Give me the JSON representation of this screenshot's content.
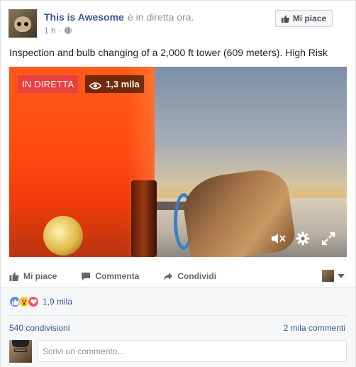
{
  "post": {
    "page_name": "This is Awesome",
    "live_status": "è in diretta ora.",
    "time": "1 h",
    "separator": "·",
    "like_page_label": "Mi piace",
    "text": "Inspection and bulb changing of a 2,000 ft tower (609 meters). High Risk"
  },
  "video": {
    "live_badge": "IN DIRETTA",
    "viewers": "1,3 mila",
    "icons": [
      "eye-icon",
      "mute-icon",
      "settings-gear-icon",
      "fullscreen-icon"
    ]
  },
  "actions": {
    "like": "Mi piace",
    "comment": "Commenta",
    "share": "Condividi"
  },
  "stats": {
    "reactions": [
      "like",
      "wow",
      "love"
    ],
    "reaction_count": "1,9 mila",
    "shares": "540 condivisioni",
    "comments": "2 mila commenti"
  },
  "comment_box": {
    "placeholder": "Scrivi un commento..."
  },
  "colors": {
    "link": "#365899",
    "live_red": "#e9413f",
    "like_blue": "#5890ff",
    "love_red": "#f25268",
    "wow_yellow": "#f7c631"
  }
}
